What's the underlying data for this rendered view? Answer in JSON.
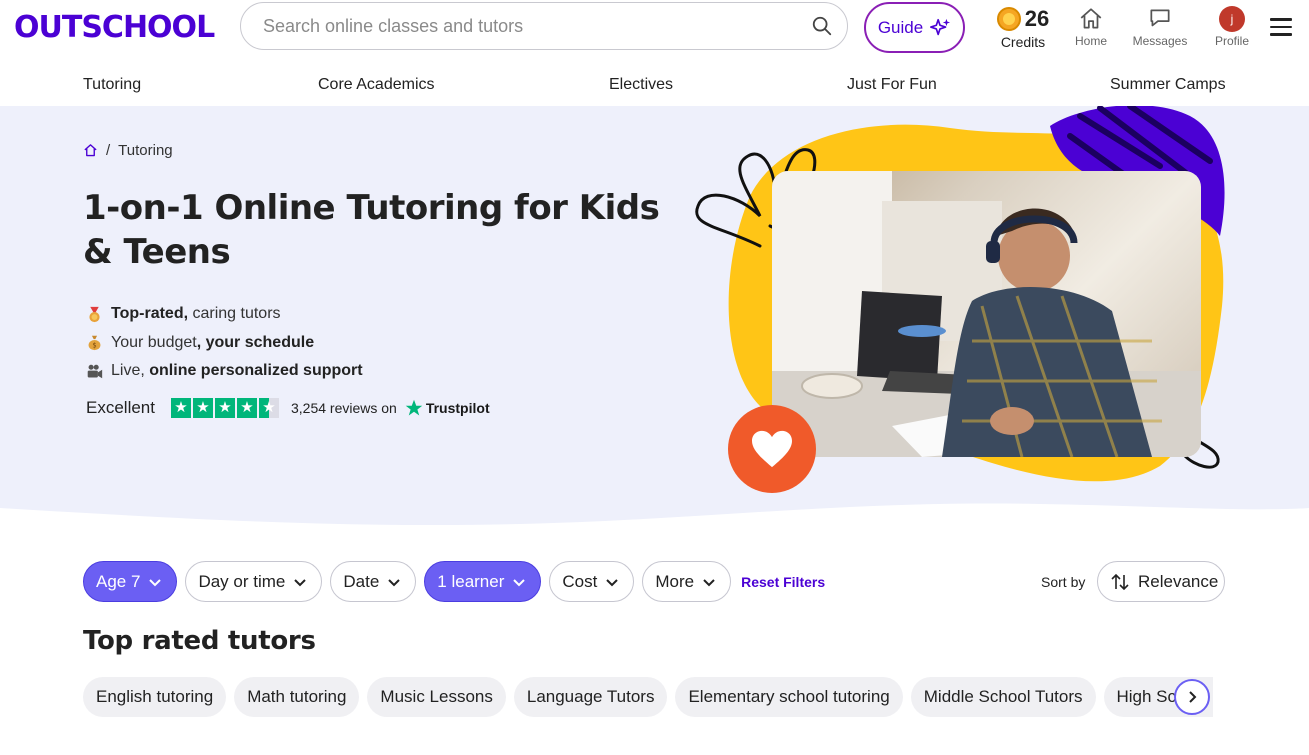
{
  "brand": {
    "logo_text": "OUTSCHOOL"
  },
  "search": {
    "placeholder": "Search online classes and tutors"
  },
  "guide": {
    "label": "Guide"
  },
  "credits": {
    "count": "26",
    "label": "Credits"
  },
  "top_nav": {
    "home": "Home",
    "messages": "Messages",
    "profile": "Profile",
    "avatar_initial": "j"
  },
  "categories": [
    "Tutoring",
    "Core Academics",
    "Electives",
    "Just For Fun",
    "Summer Camps"
  ],
  "breadcrumb": {
    "current": "Tutoring"
  },
  "hero": {
    "title": "1-on-1 Online Tutoring for Kids & Teens",
    "bullets": [
      {
        "bold": "Top-rated,",
        "text": " caring tutors"
      },
      {
        "text": "Your budget",
        "bold": ", your schedule"
      },
      {
        "text": "Live, ",
        "bold": "online personalized support"
      }
    ],
    "rating_word": "Excellent",
    "stars": 4.5,
    "reviews_text": "3,254 reviews on",
    "trustpilot": "Trustpilot"
  },
  "filters": {
    "chips": [
      {
        "label": "Age 7",
        "active": true
      },
      {
        "label": "Day or time",
        "active": false
      },
      {
        "label": "Date",
        "active": false
      },
      {
        "label": "1 learner",
        "active": true
      },
      {
        "label": "Cost",
        "active": false
      },
      {
        "label": "More",
        "active": false
      }
    ],
    "reset": "Reset Filters",
    "sort_label": "Sort by",
    "sort_value": "Relevance"
  },
  "section": {
    "title": "Top rated tutors"
  },
  "topic_pills": [
    "English tutoring",
    "Math tutoring",
    "Music Lessons",
    "Language Tutors",
    "Elementary school tutoring",
    "Middle School Tutors",
    "High School Tutors"
  ],
  "colors": {
    "brand": "#4b01d4",
    "accent": "#6b5ff3",
    "hero_bg": "#eef0fb",
    "yellow": "#ffc516",
    "heart": "#f05a2a"
  }
}
